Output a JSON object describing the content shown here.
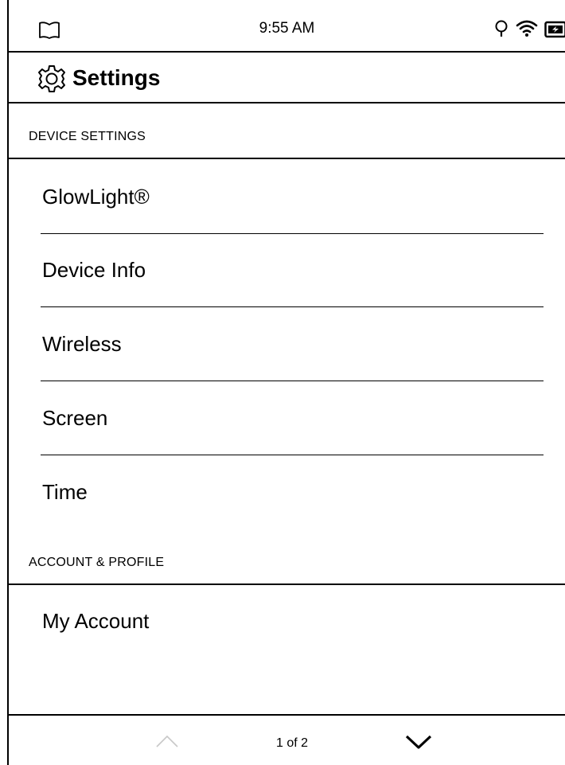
{
  "status_bar": {
    "time": "9:55 AM",
    "icons": [
      "library-icon",
      "glowlight-icon",
      "wifi-icon",
      "battery-icon"
    ]
  },
  "header": {
    "title": "Settings",
    "icon": "gear-icon"
  },
  "sections": [
    {
      "title": "DEVICE SETTINGS",
      "items": [
        "GlowLight®",
        "Device Info",
        "Wireless",
        "Screen",
        "Time"
      ]
    },
    {
      "title": "ACCOUNT & PROFILE",
      "items": [
        "My Account"
      ]
    }
  ],
  "footer": {
    "page_indicator": "1 of 2",
    "prev_enabled": false,
    "next_enabled": true
  },
  "colors": {
    "text": "#000000",
    "background": "#ffffff",
    "disabled": "#c8c8c8"
  }
}
